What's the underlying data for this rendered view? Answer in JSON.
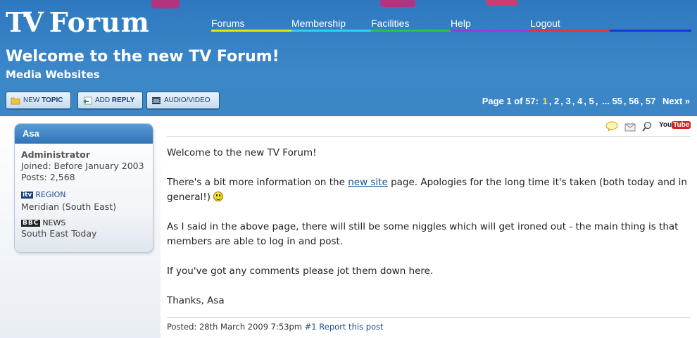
{
  "site": {
    "logo_mark": "TV",
    "logo_word": "Forum"
  },
  "nav": {
    "items": [
      {
        "label": "Forums",
        "color": "#e8e600"
      },
      {
        "label": "Membership",
        "color": "#2ad4f0"
      },
      {
        "label": "Facilities",
        "color": "#23c93c"
      },
      {
        "label": "Help",
        "color": "#9b37e0"
      },
      {
        "label": "Logout",
        "color": "#e2343a"
      }
    ],
    "extra_bar_color": "#1a34d9"
  },
  "page": {
    "title": "Welcome to the new TV Forum!",
    "subtitle": "Media Websites"
  },
  "toolbar": {
    "new_topic_prefix": "NEW",
    "new_topic_bold": "TOPIC",
    "add_reply_prefix": "ADD",
    "add_reply_bold": "REPLY",
    "audio_video": "AUDIO/VIDEO"
  },
  "pager": {
    "prefix": "Page 1 of 57:",
    "current": "1",
    "pages": [
      "2",
      "3",
      "4",
      "5",
      "...",
      "55",
      "56",
      "57"
    ],
    "next": "Next »"
  },
  "author": {
    "name": "Asa",
    "role": "Administrator",
    "joined": "Joined: Before January 2003",
    "posts": "Posts: 2,568",
    "badge1_logo": "itv",
    "badge1_label": "REGION",
    "badge1_value": "Meridian (South East)",
    "badge2_logo": "BBC",
    "badge2_label": "NEWS",
    "badge2_value": "South East Today"
  },
  "post_icons": {
    "quote": "speech-bubble-icon",
    "pm": "envelope-icon",
    "search": "magnifier-icon",
    "youtube_you": "You",
    "youtube_tube": "Tube"
  },
  "post": {
    "line1": "Welcome to the new TV Forum!",
    "p2_before": "There's a bit more information on the ",
    "p2_link": "new site",
    "p2_after": " page. Apologies for the long time it's taken (both today and in general!)",
    "p3": "As I said in the above page, there will still be some niggles which will get ironed out - the main thing is that members are able to log in and post.",
    "p4": "If you've got any comments please jot them down here.",
    "p5": "Thanks, Asa",
    "posted": "Posted: 28th March 2009 7:53pm",
    "permalink": "#1",
    "report": "Report this post"
  }
}
